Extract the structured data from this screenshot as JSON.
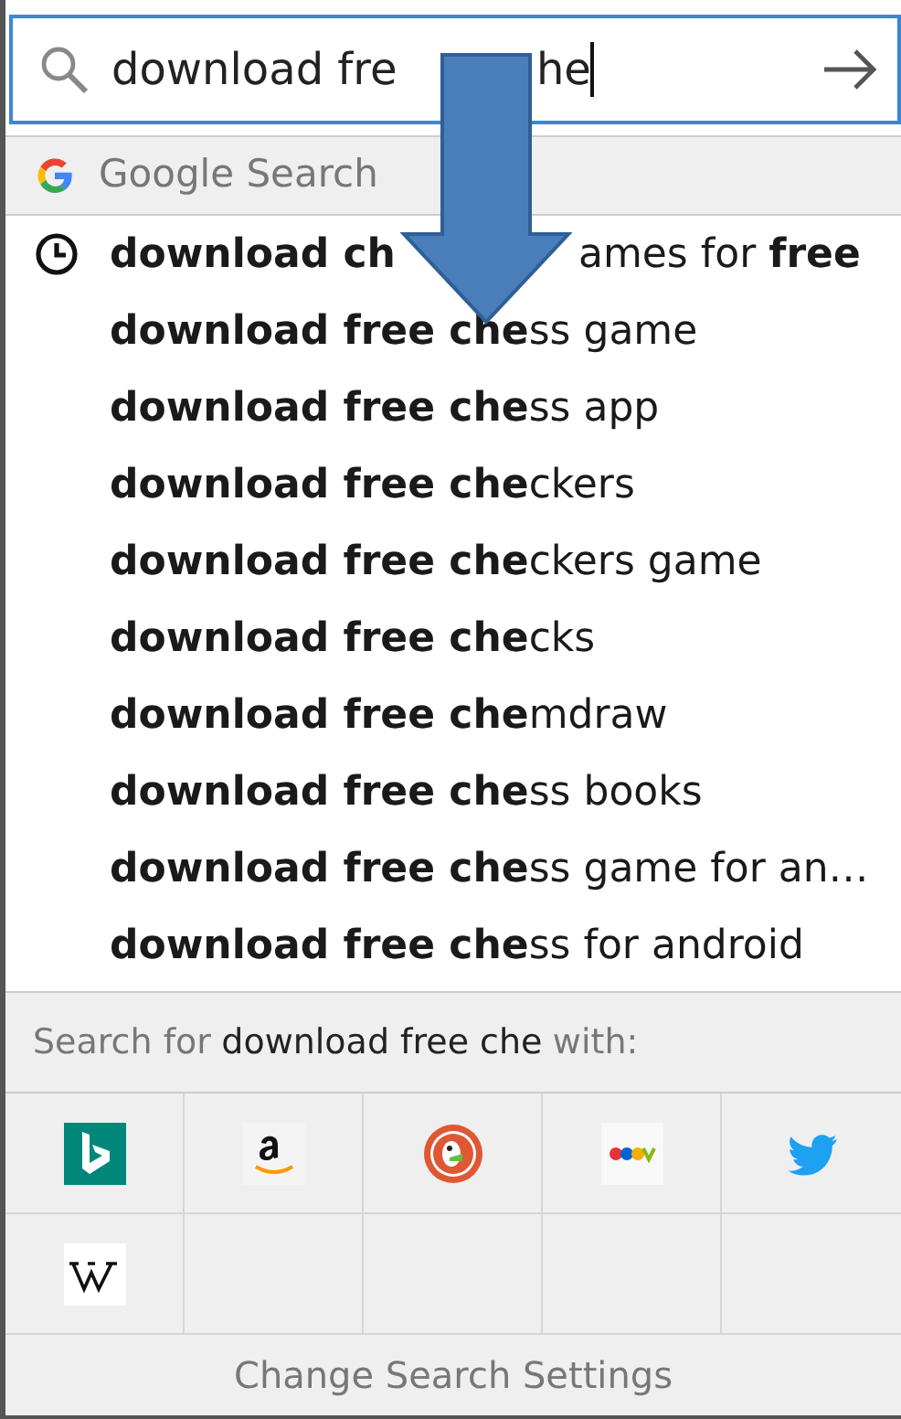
{
  "search_field": {
    "value_parts": [
      "download fre",
      "he"
    ]
  },
  "engine_header": {
    "label": "Google Search"
  },
  "suggestions": [
    {
      "kind": "history",
      "text_parts": [
        "**download ch**",
        "ames for **free**"
      ]
    },
    {
      "kind": "suggestion",
      "text": "**download free che**ss game"
    },
    {
      "kind": "suggestion",
      "text": "**download free che**ss app"
    },
    {
      "kind": "suggestion",
      "text": "**download free che**ckers"
    },
    {
      "kind": "suggestion",
      "text": "**download free che**ckers game"
    },
    {
      "kind": "suggestion",
      "text": "**download free che**cks"
    },
    {
      "kind": "suggestion",
      "text": "**download free che**mdraw"
    },
    {
      "kind": "suggestion",
      "text": "**download free che**ss books"
    },
    {
      "kind": "suggestion",
      "text": "**download free che**ss game for an…"
    },
    {
      "kind": "suggestion",
      "text": "**download free che**ss for android"
    }
  ],
  "search_with": {
    "text": "Search for **download free che** with:"
  },
  "engines": [
    {
      "kind": "bing"
    },
    {
      "kind": "amazon"
    },
    {
      "kind": "duckduckgo"
    },
    {
      "kind": "ebay"
    },
    {
      "kind": "twitter"
    },
    {
      "kind": "wikipedia"
    }
  ],
  "footer": {
    "label": "Change Search Settings"
  }
}
